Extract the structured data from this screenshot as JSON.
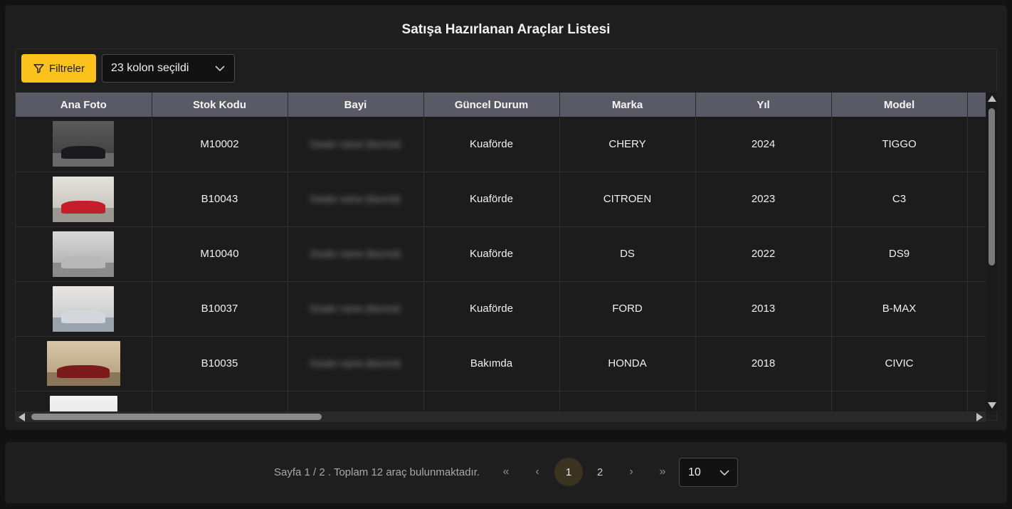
{
  "title": "Satışa Hazırlanan Araçlar Listesi",
  "toolbar": {
    "filter_label": "Filtreler",
    "column_select_value": "23 kolon seçildi"
  },
  "colors": {
    "accent": "#fbc21b",
    "header_bg": "#5a5a66",
    "page_bg": "#121212",
    "card_bg": "#1e1e1e"
  },
  "table": {
    "columns": [
      "Ana Foto",
      "Stok Kodu",
      "Bayi",
      "Güncel Durum",
      "Marka",
      "Yıl",
      "Model"
    ],
    "rows": [
      {
        "stock": "M10002",
        "dealer": "Dealer name (blurred)",
        "status": "Kuaförde",
        "brand": "CHERY",
        "year": "2024",
        "model": "TIGGO",
        "photo": "car-photo-black-suv"
      },
      {
        "stock": "B10043",
        "dealer": "Dealer name (blurred)",
        "status": "Kuaförde",
        "brand": "CITROEN",
        "year": "2023",
        "model": "C3",
        "photo": "car-photo-red-hatchback"
      },
      {
        "stock": "M10040",
        "dealer": "Dealer name (blurred)",
        "status": "Kuaförde",
        "brand": "DS",
        "year": "2022",
        "model": "DS9",
        "photo": "car-photo-silver-sedan"
      },
      {
        "stock": "B10037",
        "dealer": "Dealer name (blurred)",
        "status": "Kuaförde",
        "brand": "FORD",
        "year": "2013",
        "model": "B-MAX",
        "photo": "car-photo-silver-minivan"
      },
      {
        "stock": "B10035",
        "dealer": "Dealer name (blurred)",
        "status": "Bakımda",
        "brand": "HONDA",
        "year": "2018",
        "model": "CIVIC",
        "photo": "car-photo-red-sedan"
      },
      {
        "stock": "",
        "dealer": "",
        "status": "",
        "brand": "",
        "year": "",
        "model": "",
        "photo": "motorcycle-photo"
      }
    ]
  },
  "pagination": {
    "summary": "Sayfa 1 / 2 . Toplam 12 araç bulunmaktadır.",
    "first_icon": "«",
    "prev_icon": "‹",
    "pages": [
      "1",
      "2"
    ],
    "current": "1",
    "next_icon": "›",
    "last_icon": "»",
    "rows_per_page": "10"
  }
}
